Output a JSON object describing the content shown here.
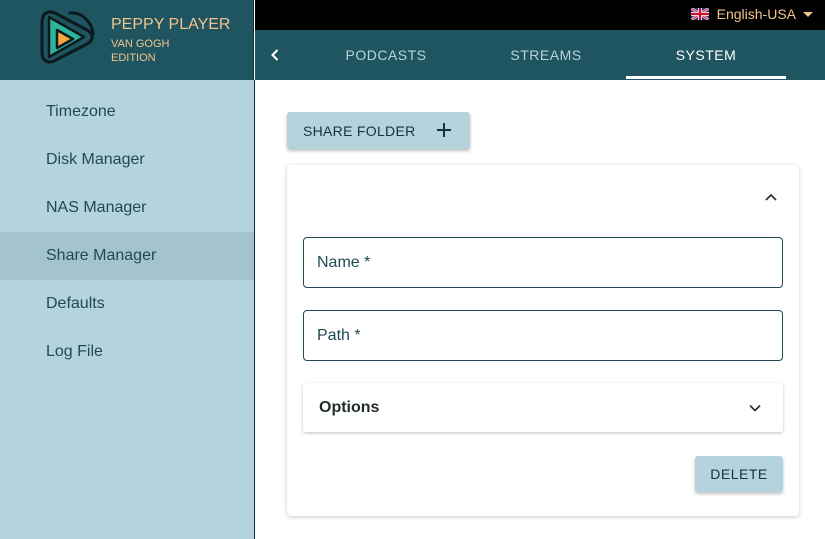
{
  "app": {
    "title": "PEPPY PLAYER",
    "subtitle_line1": "VAN GOGH",
    "subtitle_line2": "EDITION",
    "logo_icon": "peppy-play-logo-icon"
  },
  "language": {
    "label": "English-USA",
    "flag_icon": "uk-flag-icon"
  },
  "tabs": [
    {
      "label": "PODCASTS"
    },
    {
      "label": "STREAMS"
    },
    {
      "label": "SYSTEM",
      "active": true
    }
  ],
  "sidebar": {
    "items": [
      {
        "label": "Timezone"
      },
      {
        "label": "Disk Manager"
      },
      {
        "label": "NAS Manager"
      },
      {
        "label": "Share Manager",
        "selected": true
      },
      {
        "label": "Defaults"
      },
      {
        "label": "Log File"
      }
    ]
  },
  "main": {
    "share_button_label": "SHARE FOLDER",
    "name_field_label": "Name *",
    "name_field_value": "",
    "path_field_label": "Path *",
    "path_field_value": "",
    "options_label": "Options",
    "delete_label": "DELETE"
  },
  "colors": {
    "header_bg": "#1f5560",
    "accent_text": "#f2c48d",
    "sidebar_bg": "#b4d3dd",
    "sidebar_selected": "#a3c3cd",
    "button_bg": "#b4d3dd"
  }
}
